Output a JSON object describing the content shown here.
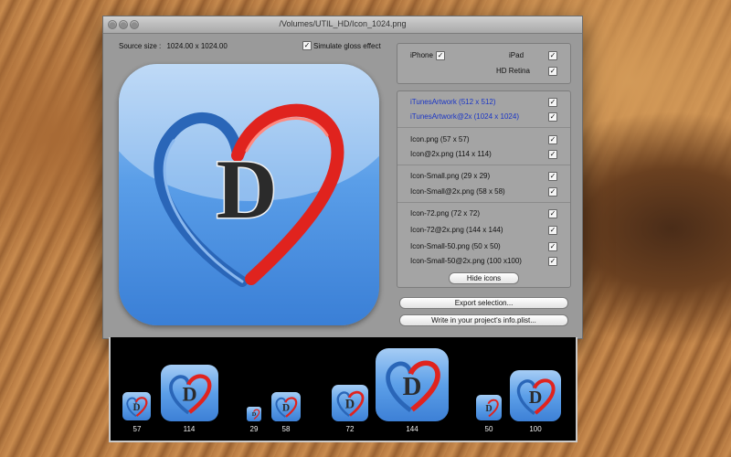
{
  "window": {
    "title": "/Volumes/UTIL_HD/Icon_1024.png"
  },
  "source": {
    "label": "Source size :",
    "value": "1024.00 x 1024.00"
  },
  "gloss": {
    "label": "Simulate gloss effect",
    "checked": "✓"
  },
  "icon": {
    "letter": "D"
  },
  "devices": {
    "iphone": "iPhone",
    "ipad": "iPad",
    "retina": "HD Retina",
    "check": "✓"
  },
  "icons": {
    "artwork": [
      "iTunesArtwork (512 x 512)",
      "iTunesArtwork@2x (1024 x 1024)"
    ],
    "phone": [
      "Icon.png (57 x 57)",
      "Icon@2x.png (114 x 114)"
    ],
    "small": [
      "Icon-Small.png (29 x 29)",
      "Icon-Small@2x.png (58 x 58)"
    ],
    "pad": [
      "Icon-72.png (72 x 72)",
      "Icon-72@2x.png (144 x 144)",
      "Icon-Small-50.png (50 x 50)",
      "Icon-Small-50@2x.png (100 x100)"
    ],
    "check": "✓"
  },
  "buttons": {
    "hide_icons": "Hide icons",
    "export": "Export selection...",
    "write_plist": "Write in your project's info.plist..."
  },
  "preview": {
    "sizes": [
      "57",
      "114",
      "29",
      "58",
      "72",
      "144",
      "50",
      "100"
    ]
  },
  "colors": {
    "link_blue": "#1a35c6",
    "heart_red": "#e0231e",
    "heart_blue": "#2a66b8"
  }
}
